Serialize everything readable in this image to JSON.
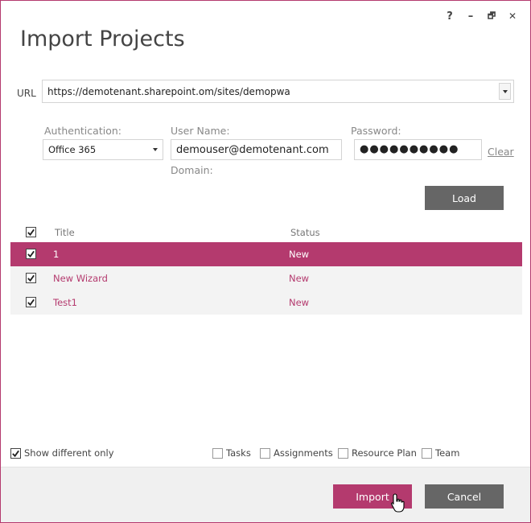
{
  "window": {
    "title": "Import Projects",
    "help_glyph": "?",
    "minimize_glyph": "–",
    "restore_glyph": "🗗",
    "close_glyph": "✕"
  },
  "url": {
    "label": "URL",
    "value": "https://demotenant.sharepoint.om/sites/demopwa"
  },
  "credentials": {
    "auth_label": "Authentication:",
    "auth_value": "Office 365",
    "username_label": "User Name:",
    "username_value": "demouser@demotenant.com",
    "domain_label": "Domain:",
    "password_label": "Password:",
    "password_mask": "●●●●●●●●●●",
    "clear_label": "Clear"
  },
  "load_label": "Load",
  "table": {
    "columns": [
      "Title",
      "Status"
    ],
    "all_checked": true,
    "rows": [
      {
        "title": "1",
        "status": "New",
        "checked": true,
        "selected": true
      },
      {
        "title": "New Wizard",
        "status": "New",
        "checked": true,
        "selected": false
      },
      {
        "title": "Test1",
        "status": "New",
        "checked": true,
        "selected": false
      }
    ]
  },
  "options": {
    "show_different_only": {
      "label": "Show different only",
      "checked": true
    },
    "tasks": {
      "label": "Tasks",
      "checked": false
    },
    "assignments": {
      "label": "Assignments",
      "checked": false
    },
    "resource_plan": {
      "label": "Resource Plan",
      "checked": false
    },
    "team": {
      "label": "Team",
      "checked": false
    }
  },
  "footer": {
    "import_label": "Import",
    "cancel_label": "Cancel"
  },
  "colors": {
    "accent": "#b43a6e",
    "button_gray": "#666666"
  }
}
